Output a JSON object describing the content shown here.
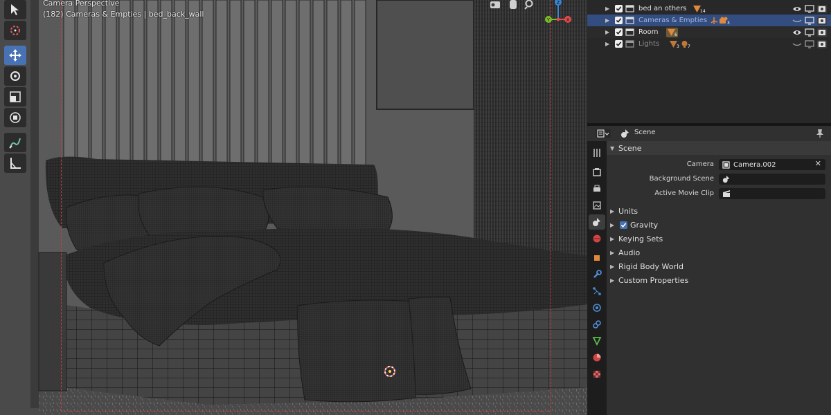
{
  "viewport": {
    "mode_label": "Camera Perspective",
    "context_label": "(182) Cameras & Empties | bed_back_wall",
    "gizmo_axes": {
      "x": "X",
      "y": "Y",
      "z": "Z"
    },
    "tools": [
      "select-box",
      "cursor",
      "move",
      "rotate",
      "scale",
      "transform",
      "annotate",
      "measure"
    ],
    "active_tool": "move"
  },
  "outliner": {
    "rows": [
      {
        "name": "bed an others",
        "badge": "14",
        "state": "normal"
      },
      {
        "name": "Cameras & Empties",
        "badge": "3",
        "state": "selected"
      },
      {
        "name": "Room",
        "badge": "6",
        "state": "normal"
      },
      {
        "name": "Lights",
        "badge": "3",
        "badge2": "7",
        "state": "dim"
      }
    ]
  },
  "properties": {
    "header_title": "Scene",
    "scene_panel_title": "Scene",
    "fields": {
      "camera": {
        "label": "Camera",
        "value": "Camera.002"
      },
      "background_scene": {
        "label": "Background Scene",
        "value": ""
      },
      "active_movie_clip": {
        "label": "Active Movie Clip",
        "value": ""
      }
    },
    "sections": [
      {
        "key": "units",
        "label": "Units"
      },
      {
        "key": "gravity",
        "label": "Gravity",
        "checked": true
      },
      {
        "key": "keying_sets",
        "label": "Keying Sets"
      },
      {
        "key": "audio",
        "label": "Audio"
      },
      {
        "key": "rigid_body_world",
        "label": "Rigid Body World"
      },
      {
        "key": "custom_properties",
        "label": "Custom Properties"
      }
    ],
    "tabs": [
      "tool",
      "render",
      "output",
      "view-layer",
      "scene",
      "world",
      "object",
      "modifiers",
      "particles",
      "physics",
      "constraints",
      "data",
      "material",
      "texture"
    ],
    "active_tab": "scene"
  },
  "colors": {
    "accent": "#4772b3",
    "selection_row": "#334d80",
    "camera_frame": "#c94040",
    "axis_x": "#e14b4b",
    "axis_y": "#7dbd2a",
    "axis_z": "#3a86d6"
  }
}
